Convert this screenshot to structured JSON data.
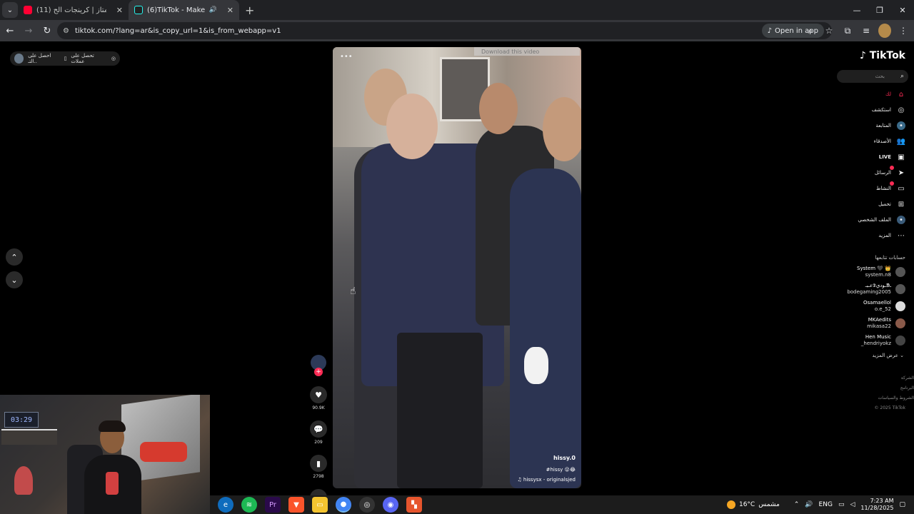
{
  "browser": {
    "tabs": [
      {
        "title": "(11) السيت الممتاز | كرينجات الح",
        "favicon_color": "#ff0033",
        "active": false
      },
      {
        "title": "(6)TikTok - Make Your Day",
        "favicon_color": "#25f4ee",
        "active": true
      }
    ],
    "url": "tiktok.com/?lang=ar&is_copy_url=1&is_from_webapp=v1",
    "open_in_app": "Open in app"
  },
  "left_pill": {
    "text1": "احصل على التـ..",
    "text2": "تحصل على عملات",
    "icon_desc": "pill-icons"
  },
  "video": {
    "download_label": "Download this video",
    "author": "hissy.0",
    "tags": "#hissy 😮😂",
    "sound": "♫ hissysx - originalsjed"
  },
  "actions": {
    "likes": "90.9K",
    "comments": "209",
    "saves": "2798",
    "shares": "872"
  },
  "sidebar": {
    "logo": "TikTok",
    "search_placeholder": "بحث",
    "items": [
      {
        "label": "لك",
        "icon": "home-icon"
      },
      {
        "label": "استكشف",
        "icon": "compass-icon"
      },
      {
        "label": "المتابعة",
        "icon": "following-icon"
      },
      {
        "label": "الأصدقاء",
        "icon": "friends-icon"
      },
      {
        "label": "LIVE",
        "icon": "live-icon"
      },
      {
        "label": "الرسائل",
        "icon": "messages-icon"
      },
      {
        "label": "النشاط",
        "icon": "activity-icon"
      },
      {
        "label": "تحميل",
        "icon": "upload-icon"
      },
      {
        "label": "الملف الشخصي",
        "icon": "profile-icon"
      },
      {
        "label": "المزيد",
        "icon": "more-icon"
      }
    ],
    "following_title": "حسابات تتابعها",
    "accounts": [
      {
        "name": "System 🖤 👑",
        "handle": "system.n8"
      },
      {
        "name": "عـبـ𝕯ـوديᱟـ",
        "handle": "bodegaming2005"
      },
      {
        "name": "Osamaellol",
        "handle": "o.e_52"
      },
      {
        "name": "MKAedits",
        "handle": "mikasa22"
      },
      {
        "name": "Hen Music",
        "handle": "_hendriyokz"
      }
    ],
    "show_more": "عرض المزيد",
    "footer": [
      "الشركة",
      "البرنامج",
      "الشروط والسياسات",
      "© 2025 TikTok"
    ]
  },
  "webcam": {
    "clock": "03:29"
  },
  "taskbar": {
    "weather": "16°C",
    "weather_text": "مشمس",
    "lang": "ENG",
    "time": "7:23 AM",
    "date": "11/28/2025"
  }
}
